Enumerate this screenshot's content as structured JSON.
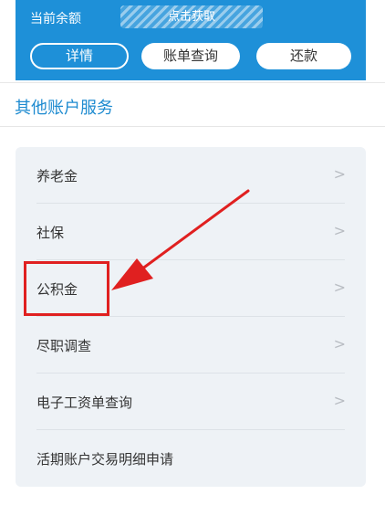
{
  "account": {
    "balance_label": "当前余额",
    "fetch_label": "点击获取",
    "buttons": {
      "details": "详情",
      "bill_query": "账单查询",
      "repay": "还款"
    }
  },
  "section": {
    "title": "其他账户服务"
  },
  "services": [
    {
      "label": "养老金"
    },
    {
      "label": "社保"
    },
    {
      "label": "公积金"
    },
    {
      "label": "尽职调查"
    },
    {
      "label": "电子工资单查询"
    },
    {
      "label": "活期账户交易明细申请"
    }
  ],
  "colors": {
    "brand_blue": "#1e90d8",
    "section_title": "#1e8bd0",
    "annotation_red": "#e02020"
  }
}
